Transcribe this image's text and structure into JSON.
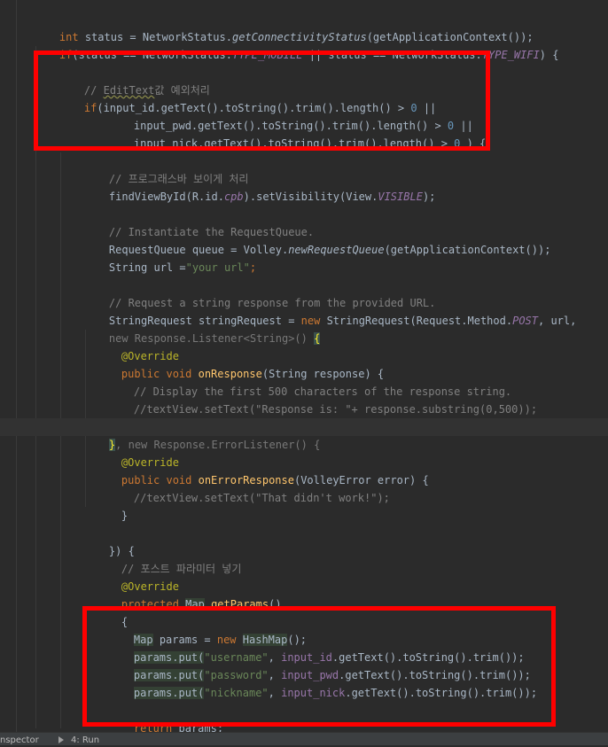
{
  "code": {
    "l1": {
      "a": "int",
      "b": " status = NetworkStatus.",
      "c": "getConnectivityStatus",
      "d": "(getApplicationContext());"
    },
    "l2": {
      "a": "if",
      "b": "(status == NetworkStatus.",
      "c": "TYPE_MOBILE",
      "d": " || status == NetworkStatus.",
      "e": "TYPE_WIFI",
      "f": ") {"
    },
    "l3": {
      "a": "// ",
      "b": "EditText",
      "c": "값 예외처리"
    },
    "l4": {
      "a": "if",
      "b": "(input_id.getText().toString().trim().length() > ",
      "c": "0",
      "d": " ||"
    },
    "l5": {
      "a": "input_pwd.getText().toString().trim().length() > ",
      "b": "0",
      "c": " ||"
    },
    "l6": {
      "a": "input_nick.getText().toString().trim().length() > ",
      "b": "0",
      "c": " ) {"
    },
    "l7": "// 프로그래스바 보이게 처리",
    "l8": {
      "a": "findViewById(R.id.",
      "b": "cpb",
      "c": ").setVisibility(View.",
      "d": "VISIBLE",
      "e": ");"
    },
    "l9": "// Instantiate the RequestQueue.",
    "l10": {
      "a": "RequestQueue queue = Volley.",
      "b": "newRequestQueue",
      "c": "(getApplicationContext());"
    },
    "l11": {
      "a": "String url =",
      "b": "\"your url\"",
      "c": ";"
    },
    "l12": "// Request a string response from the provided URL.",
    "l13": {
      "a": "StringRequest stringRequest = ",
      "b": "new",
      "c": " StringRequest(Request.Method.",
      "d": "POST",
      "e": ", url,"
    },
    "l14": {
      "a": "new Response.Listener<String>() ",
      "b": "{"
    },
    "l15": "@Override",
    "l16": {
      "a": "public void ",
      "b": "onResponse",
      "c": "(String response) {"
    },
    "l17": "// Display the first 500 characters of the response string.",
    "l18": "//textView.setText(\"Response is: \"+ response.substring(0,500));",
    "l19": "}",
    "l20": {
      "a": "}",
      "b": ", new Response.ErrorListener() {"
    },
    "l21": "@Override",
    "l22": {
      "a": "public void ",
      "b": "onErrorResponse",
      "c": "(VolleyError error) {"
    },
    "l23": "//textView.setText(\"That didn't work!\");",
    "l24": "}",
    "l25": "}) {",
    "l26": "// 포스트 파라미터 넣기",
    "l27": "@Override",
    "l28": {
      "a": "protected ",
      "b": "Map",
      "c": " ",
      "d": "getParams",
      "e": "()"
    },
    "l29": "{",
    "l30": {
      "a": "Map",
      "b": " params = ",
      "c": "new",
      "d": " ",
      "e": "HashMap",
      "f": "();"
    },
    "l31": {
      "a": "params.put(",
      "b": "\"username\"",
      "c": ", ",
      "d": "input_id",
      "e": ".getText().toString().trim());"
    },
    "l32": {
      "a": "params.put(",
      "b": "\"password\"",
      "c": ", ",
      "d": "input_pwd",
      "e": ".getText().toString().trim());"
    },
    "l33": {
      "a": "params.put(",
      "b": "\"nickname\"",
      "c": ", ",
      "d": "input_nick",
      "e": ".getText().toString().trim());"
    },
    "l34": {
      "a": "return",
      "b": " params;"
    },
    "l35": "}"
  },
  "statusbar": {
    "inspector": "nspector",
    "run": "4: Run"
  },
  "colors": {
    "highlight_box": "#ff0000",
    "background": "#2b2b2b"
  }
}
